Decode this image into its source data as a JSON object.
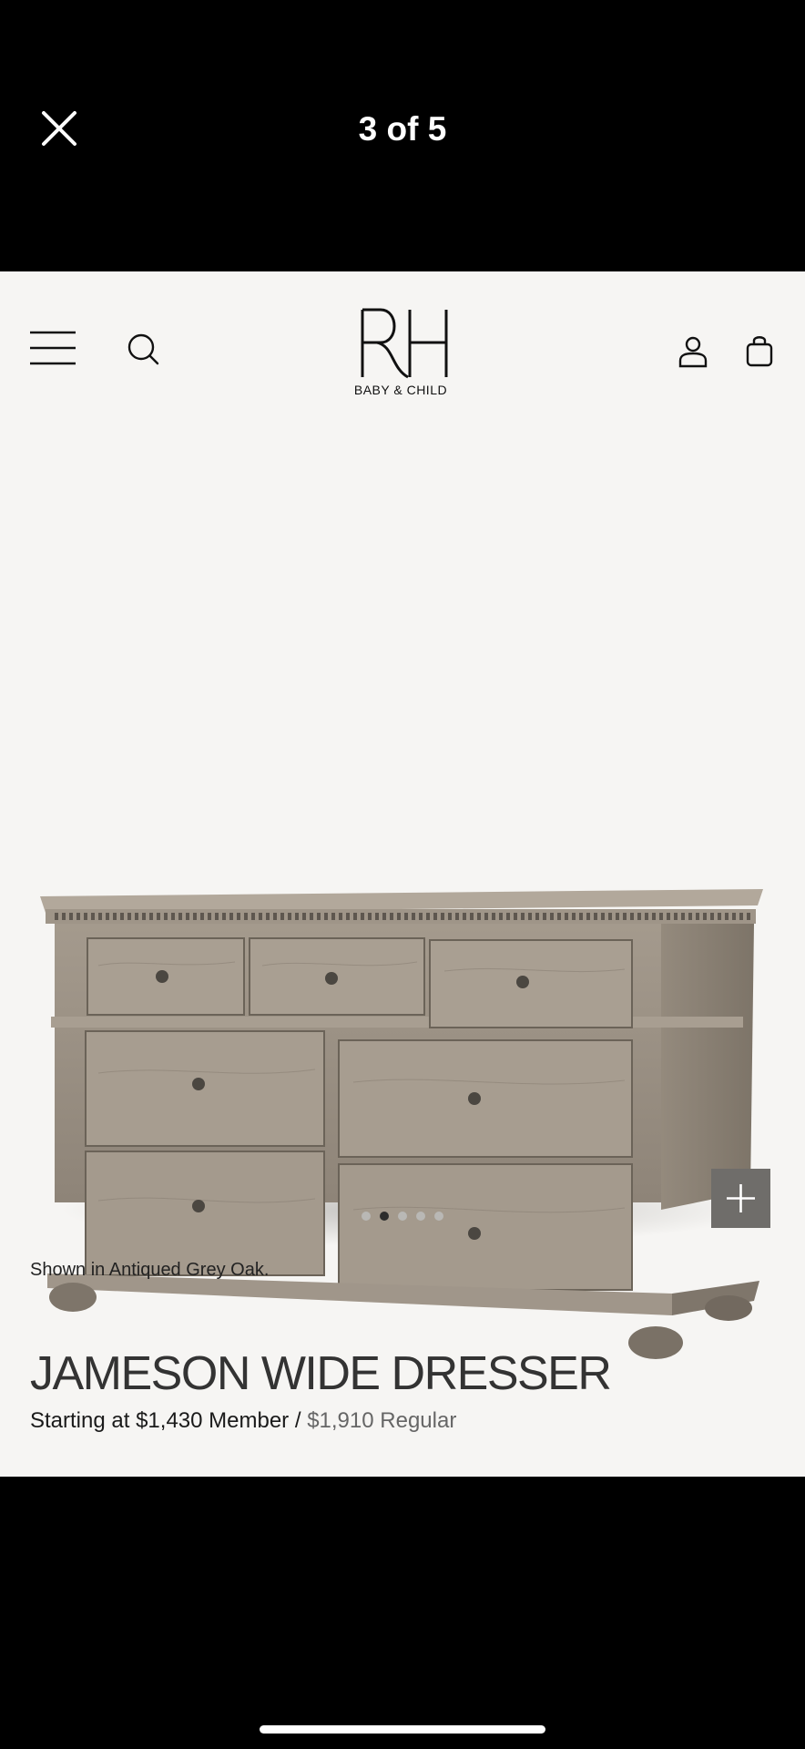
{
  "viewer": {
    "counter": "3 of 5",
    "close_icon": "close-icon"
  },
  "header": {
    "logo_letters": "RH",
    "logo_sub": "BABY & CHILD",
    "icons": [
      "menu-icon",
      "search-icon",
      "account-icon",
      "shopping-bag-icon"
    ]
  },
  "product": {
    "image_icon": "dresser-image",
    "caption": "Shown in Antiqued Grey Oak.",
    "title": "JAMESON WIDE DRESSER",
    "price_prefix": "Starting at",
    "member_price": "$1,430",
    "member_label": "Member /",
    "regular_price": "$1,910",
    "regular_label": "Regular"
  },
  "carousel": {
    "total": 5,
    "active_index": 2,
    "zoom_icon": "plus-icon"
  },
  "colors": {
    "background": "#f6f5f3",
    "chrome": "#000000",
    "zoom_button": "#6f6d6a",
    "dot_active": "#2c2c2c",
    "dot_inactive": "#b9b8b5"
  }
}
